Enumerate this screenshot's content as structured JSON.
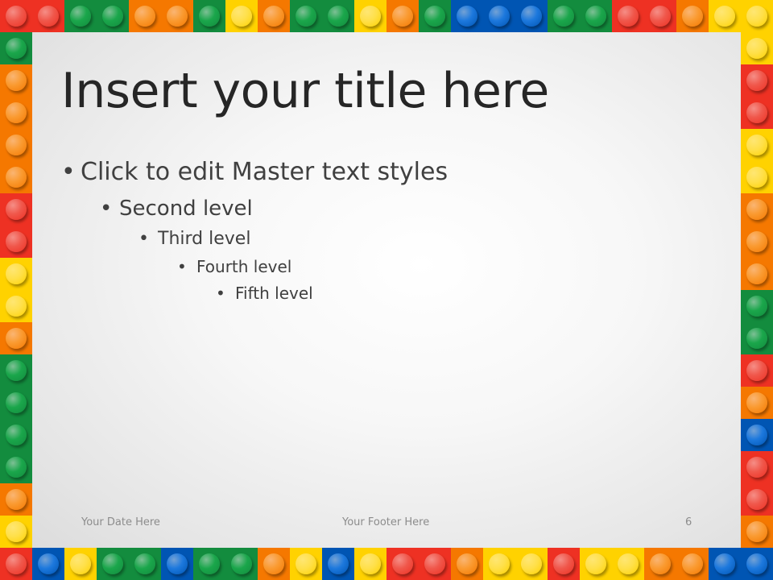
{
  "slide": {
    "title": "Insert your title here",
    "bullets": [
      {
        "level": 1,
        "text": "Click to edit Master text styles"
      },
      {
        "level": 2,
        "text": "Second level"
      },
      {
        "level": 3,
        "text": "Third level"
      },
      {
        "level": 4,
        "text": "Fourth level"
      },
      {
        "level": 5,
        "text": "Fifth level"
      }
    ],
    "bullet_glyph": "•",
    "footer": {
      "date": "Your Date Here",
      "text": "Your Footer Here",
      "page_number": "6"
    }
  },
  "border": {
    "palette": {
      "R": {
        "base": "#ee3123",
        "stud": "#f0574b"
      },
      "G": {
        "base": "#138c3e",
        "stud": "#1aa64b"
      },
      "O": {
        "base": "#f57800",
        "stud": "#fa9a30"
      },
      "Y": {
        "base": "#ffd200",
        "stud": "#ffe04a"
      },
      "B": {
        "base": "#0055b3",
        "stud": "#1c78dd"
      }
    },
    "top": "RRGGOOGYOGGYOGBBBGGRROYY",
    "bottom": "RBYGGBGGOYBYRROYYRYYOOBB",
    "left": "GOOOORRYYOGGGGOY",
    "right": "YRRYYOOOGGROBRRO"
  }
}
